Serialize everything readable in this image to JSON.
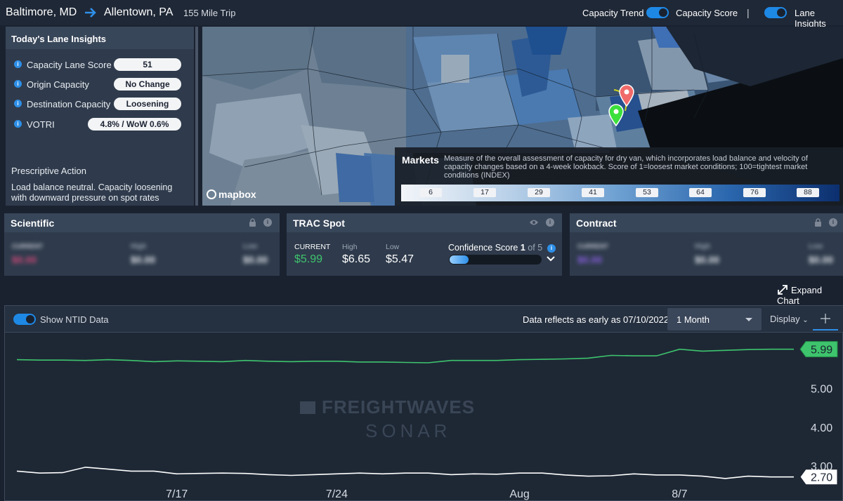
{
  "header": {
    "origin": "Baltimore, MD",
    "destination": "Allentown, PA",
    "trip": "155 Mile Trip",
    "capacity_trend_label": "Capacity Trend",
    "capacity_score_label": "Capacity Score",
    "separator": "|",
    "lane_insights_label": "Lane Insights"
  },
  "insights": {
    "title": "Today's Lane Insights",
    "rows": [
      {
        "label": "Capacity Lane Score",
        "value": "51"
      },
      {
        "label": "Origin Capacity",
        "value": "No Change"
      },
      {
        "label": "Destination Capacity",
        "value": "Loosening"
      },
      {
        "label": "VOTRI",
        "value": "4.8% / WoW 0.6%"
      }
    ],
    "prescriptive_title": "Prescriptive Action",
    "prescriptive_text": "Load balance neutral. Capacity loosening with downward pressure on spot rates"
  },
  "map": {
    "attribution": "mapbox",
    "markets_title": "Markets",
    "markets_desc": "Measure of the overall assessment of capacity for dry van, which incorporates load balance and velocity of capacity changes based on a 4-week lookback. Score of 1=loosest market conditions; 100=tightest market conditions (INDEX)",
    "legend_ticks": [
      "6",
      "17",
      "29",
      "41",
      "53",
      "64",
      "76",
      "88"
    ],
    "origin_pin_color": "#3be03b",
    "destination_pin_color": "#f06a6a"
  },
  "cards": {
    "scientific": {
      "title": "Scientific",
      "current_label": "CURRENT",
      "current": "$0.00",
      "high_label": "High",
      "high": "$0.00",
      "low_label": "Low",
      "low": "$0.00"
    },
    "trac": {
      "title": "TRAC Spot",
      "current_label": "CURRENT",
      "current": "$5.99",
      "high_label": "High",
      "high": "$6.65",
      "low_label": "Low",
      "low": "$5.47",
      "confidence_label": "Confidence Score",
      "confidence_value": "1",
      "confidence_of": "of 5",
      "confidence": 1,
      "confidence_max": 5
    },
    "contract": {
      "title": "Contract",
      "current_label": "CURRENT",
      "current": "$0.00",
      "high_label": "High",
      "high": "$0.00",
      "low_label": "Low",
      "low": "$0.00"
    }
  },
  "expand_label": "Expand Chart",
  "chart_toolbar": {
    "ntid_label": "Show NTID Data",
    "data_reflects": "Data reflects as early as 07/10/2022",
    "range": "1 Month",
    "display": "Display"
  },
  "watermark": {
    "line1": "FREIGHTWAVES",
    "line2": "SONAR"
  },
  "chart_data": {
    "type": "line",
    "x_tick_labels": [
      "7/17",
      "7/24",
      "Aug",
      "8/7"
    ],
    "y_tick_labels": [
      "3.00",
      "4.00",
      "5.00"
    ],
    "ylim": [
      2.55,
      6.4
    ],
    "grid": false,
    "series": [
      {
        "color": "#3ec46d",
        "last_label": "5.99",
        "values": [
          5.72,
          5.71,
          5.71,
          5.7,
          5.72,
          5.7,
          5.67,
          5.69,
          5.68,
          5.67,
          5.7,
          5.68,
          5.67,
          5.68,
          5.68,
          5.66,
          5.66,
          5.65,
          5.64,
          5.7,
          5.7,
          5.7,
          5.72,
          5.73,
          5.74,
          5.76,
          5.83,
          5.82,
          5.82,
          5.99,
          5.94,
          5.96,
          5.98,
          5.99,
          5.99
        ]
      },
      {
        "color": "#ffffff",
        "last_label": "2.70",
        "values": [
          2.85,
          2.8,
          2.81,
          2.95,
          2.9,
          2.85,
          2.85,
          2.78,
          2.79,
          2.8,
          2.79,
          2.76,
          2.74,
          2.76,
          2.78,
          2.8,
          2.78,
          2.8,
          2.8,
          2.76,
          2.78,
          2.77,
          2.8,
          2.8,
          2.75,
          2.72,
          2.73,
          2.78,
          2.75,
          2.75,
          2.72,
          2.66,
          2.72,
          2.7,
          2.7
        ]
      }
    ]
  }
}
